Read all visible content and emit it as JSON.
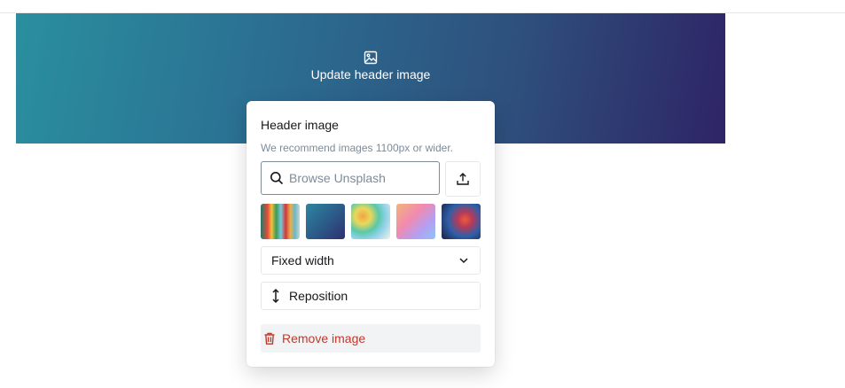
{
  "header": {
    "update_label": "Update header image",
    "gradient_start": "#2a8f9f",
    "gradient_end": "#2e2466"
  },
  "popover": {
    "title": "Header image",
    "hint": "We recommend images 1100px or wider.",
    "search": {
      "placeholder": "Browse Unsplash",
      "value": ""
    },
    "upload_icon": "upload-icon",
    "thumbnails": [
      {
        "icon": "rainbow-stripes-thumbnail"
      },
      {
        "icon": "blue-gradient-thumbnail"
      },
      {
        "icon": "color-powder-thumbnail"
      },
      {
        "icon": "pastel-gradient-thumbnail"
      },
      {
        "icon": "fire-smoke-thumbnail"
      }
    ],
    "width_select": {
      "value": "Fixed width"
    },
    "reposition_label": "Reposition",
    "remove_label": "Remove image",
    "accent_danger": "#c0392b"
  }
}
